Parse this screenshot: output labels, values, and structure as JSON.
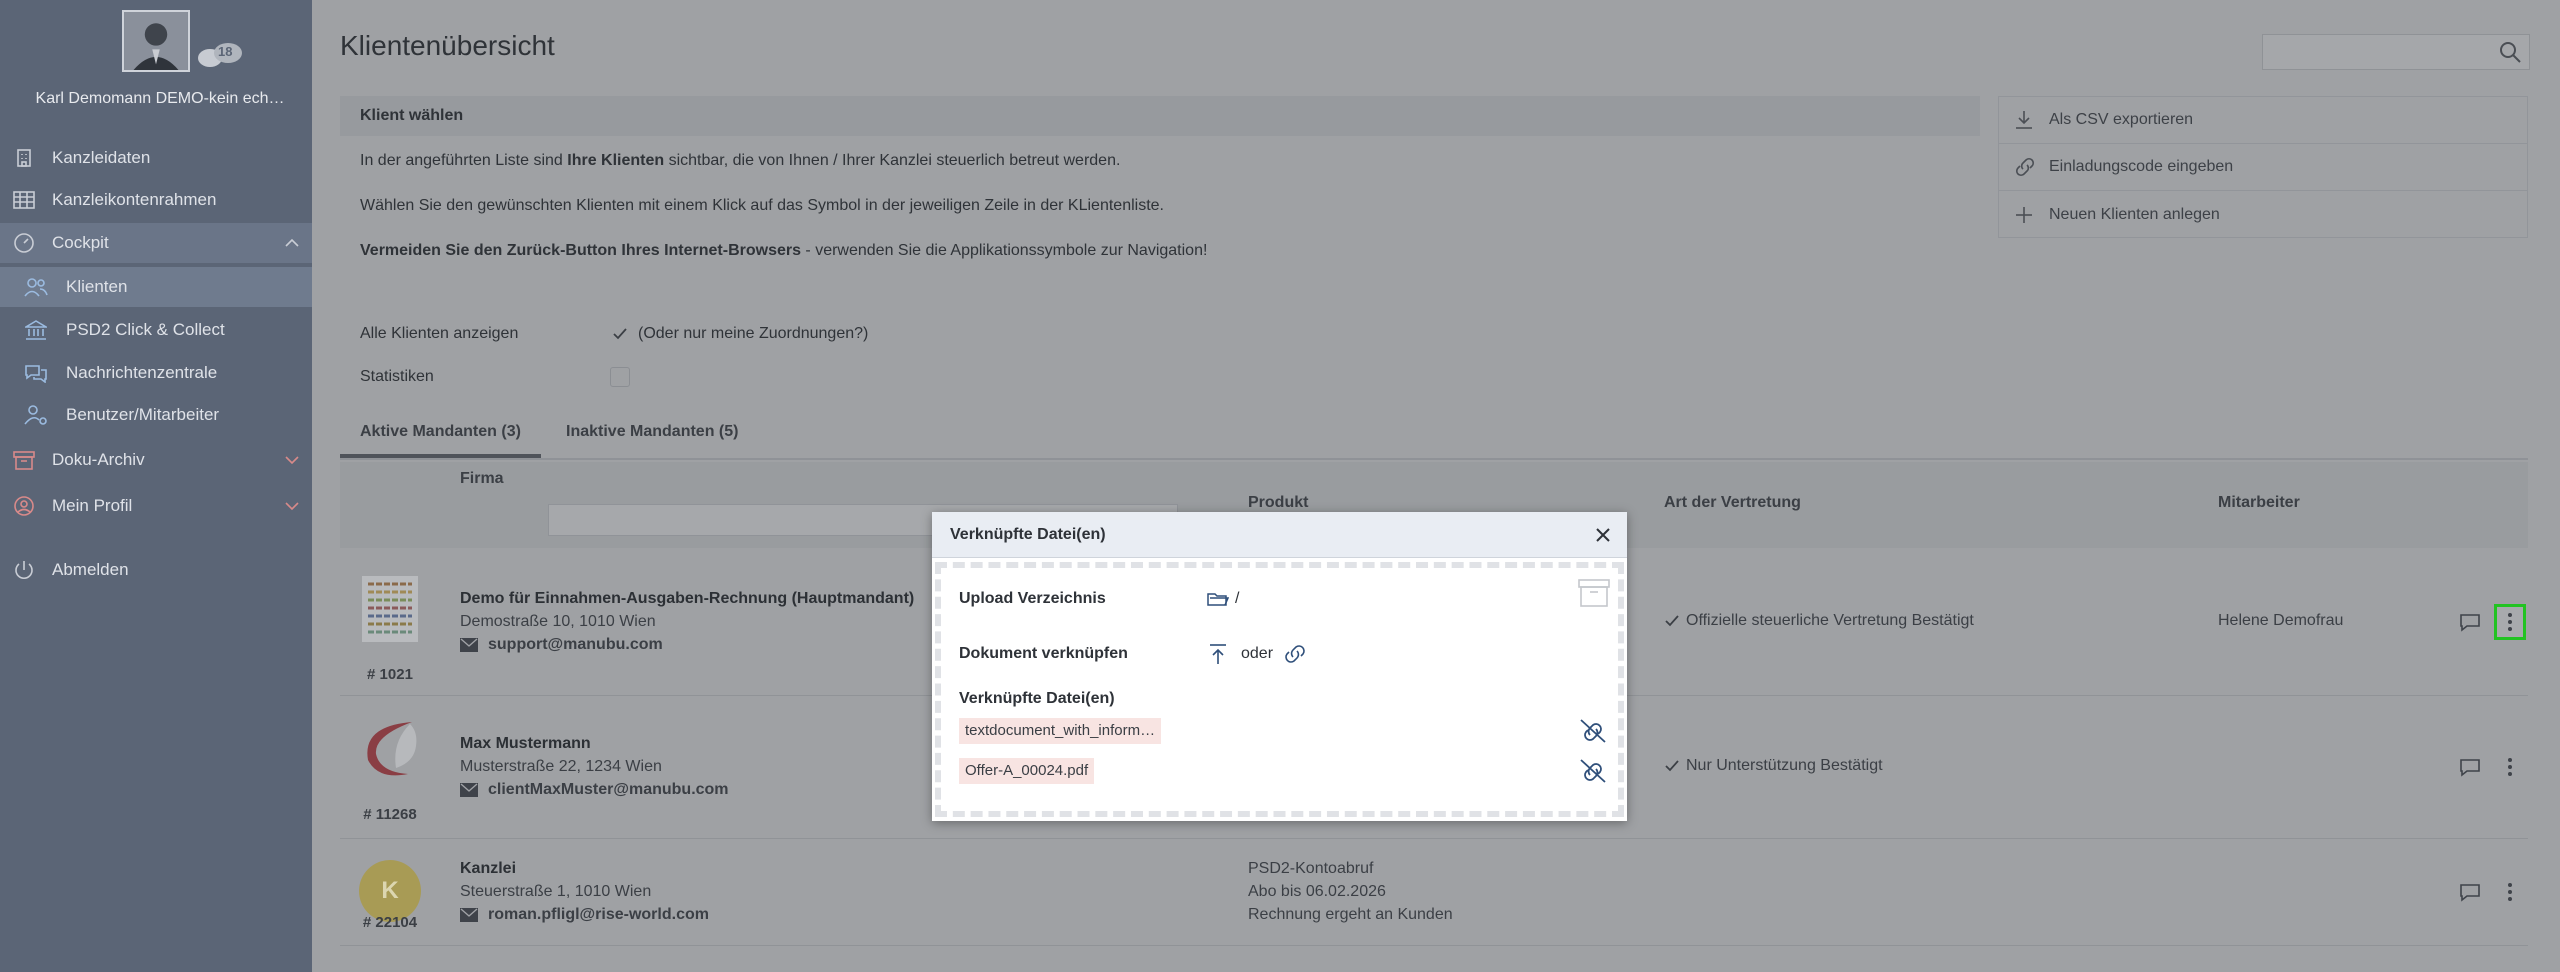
{
  "sidebar": {
    "user_name": "Karl Demomann DEMO-kein ech…",
    "chat_count": "18",
    "items": [
      {
        "label": "Kanzleidaten",
        "icon": "building-icon"
      },
      {
        "label": "Kanzleikontenrahmen",
        "icon": "grid-icon"
      },
      {
        "label": "Cockpit",
        "icon": "gauge-icon"
      },
      {
        "label": "Klienten",
        "icon": "users-icon"
      },
      {
        "label": "PSD2 Click & Collect",
        "icon": "bank-icon"
      },
      {
        "label": "Nachrichtenzentrale",
        "icon": "chat-icon"
      },
      {
        "label": "Benutzer/Mitarbeiter",
        "icon": "user-gear-icon"
      },
      {
        "label": "Doku-Archiv",
        "icon": "archive-icon"
      },
      {
        "label": "Mein Profil",
        "icon": "profile-icon"
      },
      {
        "label": "Abmelden",
        "icon": "power-icon"
      }
    ]
  },
  "page": {
    "title": "Klientenübersicht",
    "search_placeholder": ""
  },
  "info": {
    "heading": "Klient wählen",
    "line1_pre": "In der angeführten Liste sind ",
    "line1_bold": "Ihre Klienten",
    "line1_post": " sichtbar, die von Ihnen / Ihrer Kanzlei steuerlich betreut werden.",
    "line2": "Wählen Sie den gewünschten Klienten mit einem Klick auf das Symbol in der jeweiligen Zeile in der KLientenliste.",
    "line3_bold": "Vermeiden Sie den Zurück-Button Ihres Internet-Browsers",
    "line3_post": " - verwenden Sie die Applikationssymbole zur Navigation!"
  },
  "actions": {
    "csv": "Als CSV exportieren",
    "invite": "Einladungscode eingeben",
    "new_client": "Neuen Klienten anlegen"
  },
  "options": {
    "all_clients_label": "Alle Klienten anzeigen",
    "all_clients_note": "(Oder nur meine Zuordnungen?)",
    "statistics_label": "Statistiken"
  },
  "tabs": {
    "active": "Aktive Mandanten (3)",
    "inactive": "Inaktive Mandanten (5)"
  },
  "table": {
    "headers": {
      "firma": "Firma",
      "produkt": "Produkt",
      "vertretung": "Art der Vertretung",
      "mitarbeiter": "Mitarbeiter"
    },
    "rows": [
      {
        "number": "# 1021",
        "name": "Demo für Einnahmen-Ausgaben-Rechnung (Hauptmandant)",
        "address": "Demostraße 10, 1010 Wien",
        "email": "support@manubu.com",
        "vertretung": "Offizielle steuerliche Vertretung Bestätigt",
        "mitarbeiter": "Helene Demofrau"
      },
      {
        "number": "# 11268",
        "name": "Max Mustermann",
        "address": "Musterstraße 22, 1234 Wien",
        "email": "clientMaxMuster@manubu.com",
        "vertretung": "Nur Unterstützung Bestätigt",
        "mitarbeiter": ""
      },
      {
        "number": "# 22104",
        "logo_letter": "K",
        "name": "Kanzlei",
        "address": "Steuerstraße 1, 1010 Wien",
        "email": "roman.pfligl@rise-world.com",
        "produkt_line1": "PSD2-Kontoabruf",
        "produkt_line2": "Abo bis 06.02.2026",
        "produkt_line3": "Rechnung ergeht an Kunden"
      }
    ]
  },
  "modal": {
    "title": "Verknüpfte Datei(en)",
    "upload_label": "Upload Verzeichnis",
    "upload_value": "/",
    "link_label": "Dokument verknüpfen",
    "link_or": "oder",
    "files_label": "Verknüpfte Datei(en)",
    "files": [
      "textdocument_with_inform…",
      "Offer-A_00024.pdf"
    ]
  },
  "colors": {
    "sidebar": "#5b6576",
    "overlay_main": "#9fa1a4",
    "highlight": "#22c322",
    "file_chip": "#f8e4e2",
    "modal_header": "#e9edf3"
  }
}
